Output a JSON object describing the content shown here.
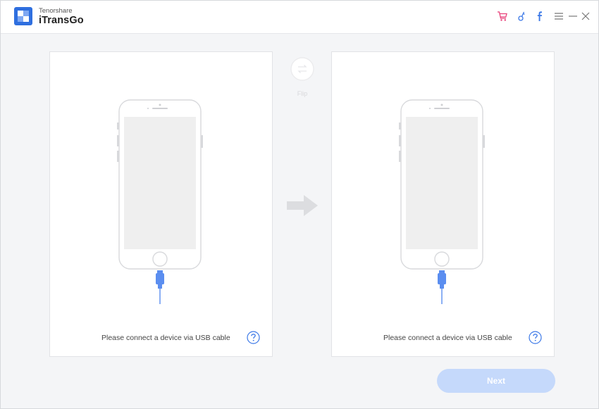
{
  "app": {
    "vendor": "Tenorshare",
    "name": "iTransGo"
  },
  "titlebar": {
    "icons": [
      "cart-icon",
      "key-icon",
      "facebook-icon",
      "menu-icon",
      "minimize-icon",
      "close-icon"
    ]
  },
  "source_panel": {
    "message": "Please connect a device via USB cable"
  },
  "target_panel": {
    "message": "Please connect a device via USB cable"
  },
  "flip": {
    "label": "Flip"
  },
  "footer": {
    "next_label": "Next"
  },
  "colors": {
    "brand_blue": "#3b78e7",
    "cable_blue": "#5b8ef0",
    "accent_pink": "#e8417a",
    "next_disabled": "#c5d9fb"
  }
}
